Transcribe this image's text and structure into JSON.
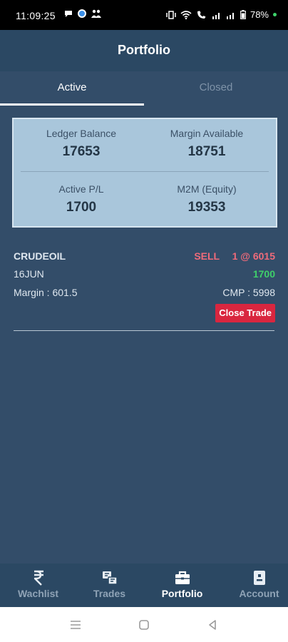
{
  "status_bar": {
    "time": "11:09:25",
    "battery": "78%"
  },
  "header": {
    "title": "Portfolio"
  },
  "tabs": [
    {
      "label": "Active",
      "active": true
    },
    {
      "label": "Closed",
      "active": false
    }
  ],
  "summary": {
    "ledger_balance_label": "Ledger Balance",
    "ledger_balance_value": "17653",
    "margin_available_label": "Margin Available",
    "margin_available_value": "18751",
    "active_pl_label": "Active P/L",
    "active_pl_value": "1700",
    "m2m_label": "M2M (Equity)",
    "m2m_value": "19353"
  },
  "positions": [
    {
      "symbol": "CRUDEOIL",
      "expiry": "16JUN",
      "margin": "Margin : 601.5",
      "side": "SELL",
      "qty_price": "1 @ 6015",
      "pnl": "1700",
      "cmp": "CMP : 5998",
      "close_label": "Close Trade"
    }
  ],
  "bottom_nav": [
    {
      "label": "Wachlist",
      "icon": "rupee-icon",
      "active": false
    },
    {
      "label": "Trades",
      "icon": "trades-icon",
      "active": false
    },
    {
      "label": "Portfolio",
      "icon": "briefcase-icon",
      "active": true
    },
    {
      "label": "Account",
      "icon": "account-card-icon",
      "active": false
    }
  ],
  "colors": {
    "background": "#334d69",
    "header": "#2b4863",
    "summary_bg": "#a9c6db",
    "sell": "#ef6b7a",
    "profit": "#3fd06a",
    "close_button": "#d9263f"
  }
}
